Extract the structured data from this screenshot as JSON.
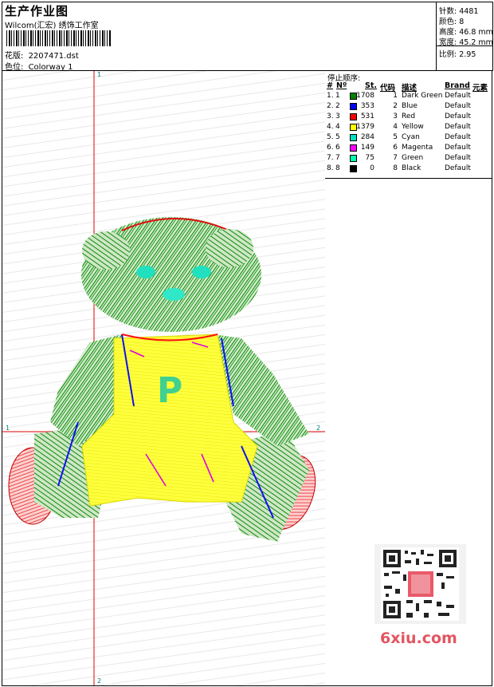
{
  "header": {
    "title": "生产作业图",
    "company": "Wilcom(汇宏) 绣饰工作室",
    "design_label": "花版:",
    "design_file": "2207471.dst",
    "colorway_label": "色位:",
    "colorway": "Colorway 1"
  },
  "stats": {
    "stitches_label": "针数:",
    "stitches": "4481",
    "colors_label": "颜色:",
    "colors": "8",
    "height_label": "高度:",
    "height": "46.8 mm",
    "width_label": "宽度:",
    "width": "45.2 mm",
    "scale_label": "比例:",
    "scale": "2.95"
  },
  "design": {
    "axis_labels": {
      "v_top": "1",
      "v_bottom": "2",
      "h_left": "1",
      "h_right": "2"
    },
    "letter": "P"
  },
  "stop_sequence": {
    "title": "停止顺序:",
    "headers": {
      "hash": "#",
      "no": "Nº",
      "st": "St.",
      "code": "代码",
      "desc": "描述",
      "brand": "Brand",
      "element": "元素"
    },
    "rows": [
      {
        "hash": "1.",
        "no": "1",
        "color": "#008000",
        "st": "1708",
        "code": "1",
        "desc": "Dark Green",
        "brand": "Default"
      },
      {
        "hash": "2.",
        "no": "2",
        "color": "#0000ff",
        "st": "353",
        "code": "2",
        "desc": "Blue",
        "brand": "Default"
      },
      {
        "hash": "3.",
        "no": "3",
        "color": "#ff0000",
        "st": "531",
        "code": "3",
        "desc": "Red",
        "brand": "Default"
      },
      {
        "hash": "4.",
        "no": "4",
        "color": "#ffff00",
        "st": "1379",
        "code": "4",
        "desc": "Yellow",
        "brand": "Default"
      },
      {
        "hash": "5.",
        "no": "5",
        "color": "#00e0c0",
        "st": "284",
        "code": "5",
        "desc": "Cyan",
        "brand": "Default"
      },
      {
        "hash": "6.",
        "no": "6",
        "color": "#ff00ff",
        "st": "149",
        "code": "6",
        "desc": "Magenta",
        "brand": "Default"
      },
      {
        "hash": "7.",
        "no": "7",
        "color": "#00ffb0",
        "st": "75",
        "code": "7",
        "desc": "Green",
        "brand": "Default"
      },
      {
        "hash": "8.",
        "no": "8",
        "color": "#000000",
        "st": "0",
        "code": "8",
        "desc": "Black",
        "brand": "Default"
      }
    ]
  },
  "watermark": "6xiu.com"
}
